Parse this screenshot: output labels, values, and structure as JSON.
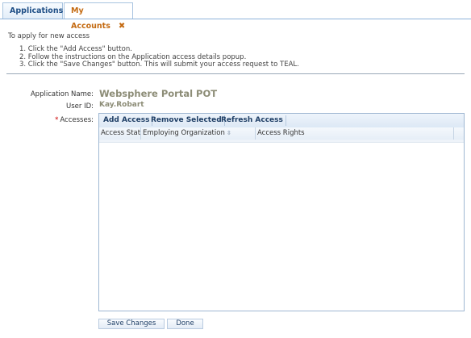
{
  "tabs": [
    {
      "label": "Applications",
      "active": false
    },
    {
      "label": "My Accounts",
      "active": true,
      "close_glyph": "✖"
    }
  ],
  "instructions": {
    "intro": "To apply for new access",
    "steps": [
      "1.  Click the \"Add Access\" button.",
      "2.  Follow the instructions on the Application access details popup.",
      "3.  Click the \"Save Changes\" button. This will submit your access request to TEAL."
    ]
  },
  "form": {
    "application_name_label": "Application Name:",
    "application_name_value": "Websphere Portal POT",
    "user_id_label": "User ID:",
    "user_id_value": "Kay.Robart",
    "accesses_required_mark": "*",
    "accesses_label": "Accesses:"
  },
  "grid": {
    "toolbar": {
      "add_access": "Add Access",
      "remove_selected": "Remove Selected",
      "refresh_access": "Refresh Access"
    },
    "columns": [
      "Access Stat",
      "Employing Organization",
      "Access Rights"
    ],
    "sort_icon": "sort-icon",
    "rows": []
  },
  "buttons": {
    "save": "Save Changes",
    "done": "Done"
  },
  "colors": {
    "active_tab_text": "#c46a11",
    "tab_text": "#1f4f86",
    "value_text": "#8c8c76",
    "required": "#cc0000"
  }
}
